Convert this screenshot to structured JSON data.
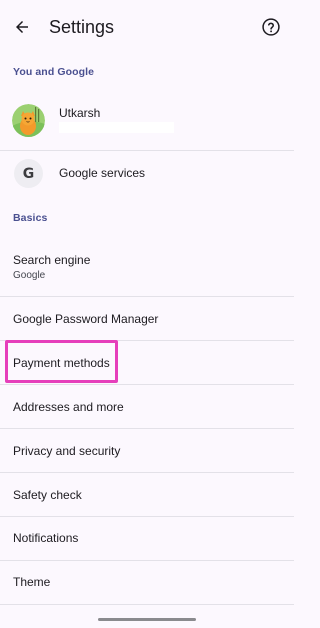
{
  "header": {
    "title": "Settings",
    "back_icon": "arrow-back-icon",
    "help_icon": "help-circle-icon"
  },
  "sections": {
    "you_and_google": "You and Google",
    "basics": "Basics"
  },
  "profile": {
    "name": "Utkarsh",
    "avatar_icon": "avatar-cat-icon"
  },
  "google_services": {
    "label": "Google services",
    "icon_letter": "G"
  },
  "search_engine": {
    "label": "Search engine",
    "value": "Google"
  },
  "items": {
    "password_manager": "Google Password Manager",
    "payment_methods": "Payment methods",
    "addresses": "Addresses and more",
    "privacy": "Privacy and security",
    "safety_check": "Safety check",
    "notifications": "Notifications",
    "theme": "Theme"
  },
  "colors": {
    "background": "#fcf8fe",
    "section_header": "#4a5090",
    "highlight": "#e63fbb",
    "divider": "#e3e1e8"
  }
}
